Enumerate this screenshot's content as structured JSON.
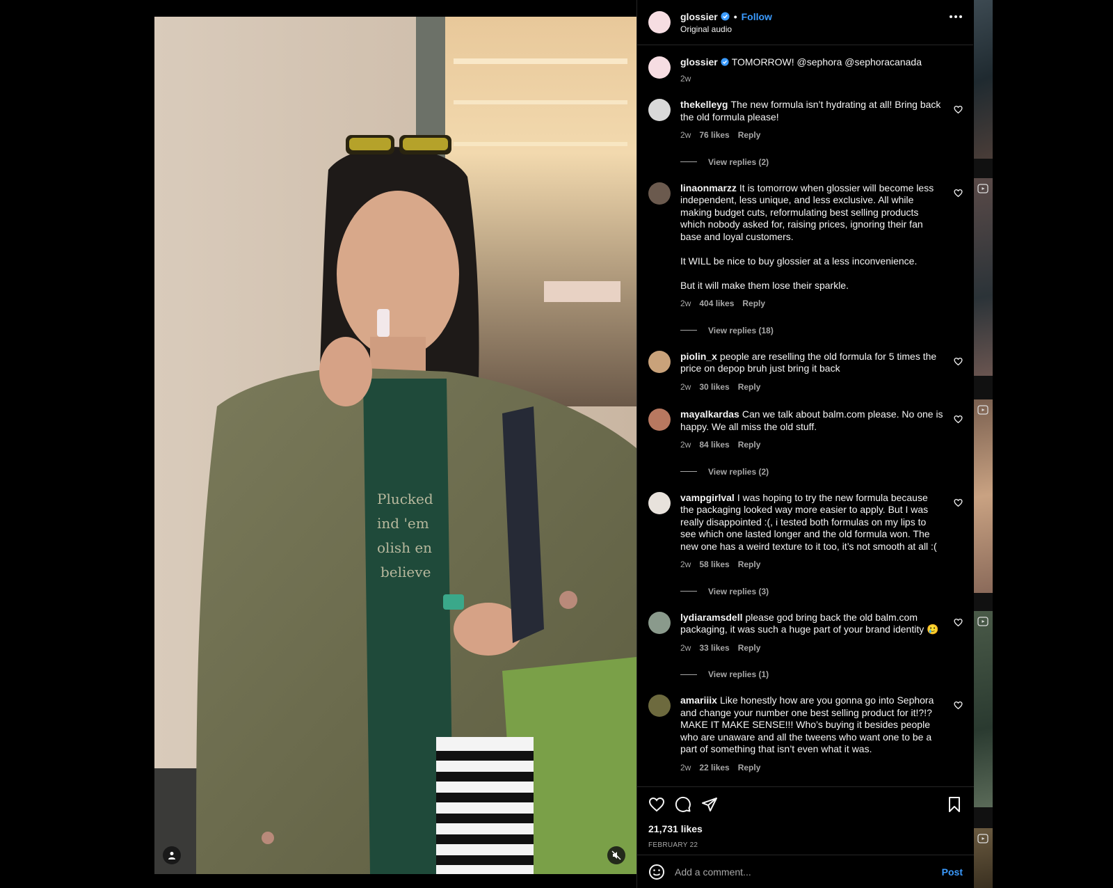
{
  "post": {
    "username": "glossier",
    "verified": true,
    "follow_label": "Follow",
    "separator": "•",
    "audio": "Original audio",
    "likes": "21,731 likes",
    "date": "FEBRUARY 22"
  },
  "caption": {
    "username": "glossier",
    "text": "TOMORROW! @sephora @sephoracanada",
    "time": "2w"
  },
  "comments": [
    {
      "user": "thekelleyg",
      "text": "The new formula isn’t hydrating at all! Bring back the old formula please!",
      "time": "2w",
      "likes": "76 likes",
      "reply": "Reply",
      "replies": "View replies (2)",
      "avatar_color": "#d9d9d9"
    },
    {
      "user": "linaonmarzz",
      "text": "It is tomorrow when glossier will become less independent, less unique, and less exclusive. All while making budget cuts, reformulating best selling products which nobody asked for, raising prices, ignoring their fan base and loyal customers.\n\nIt WILL be nice to buy glossier at a less inconvenience.\n\nBut it will make them lose their sparkle.",
      "time": "2w",
      "likes": "404 likes",
      "reply": "Reply",
      "replies": "View replies (18)",
      "avatar_color": "#6b5a4e"
    },
    {
      "user": "piolin_x",
      "text": "people are reselling the old formula for 5 times the price on depop bruh just bring it back",
      "time": "2w",
      "likes": "30 likes",
      "reply": "Reply",
      "replies": "",
      "avatar_color": "#c9a27a"
    },
    {
      "user": "mayalkardas",
      "text": "Can we talk about balm.com please. No one is happy. We all miss the old stuff.",
      "time": "2w",
      "likes": "84 likes",
      "reply": "Reply",
      "replies": "View replies (2)",
      "avatar_color": "#b87860"
    },
    {
      "user": "vampgirlval",
      "text": "I was hoping to try the new formula because the packaging looked way more easier to apply. But I was really disappointed :(, i tested both formulas on my lips to see which one lasted longer and the old formula won. The new one has a weird texture to it too, it’s not smooth at all :(",
      "time": "2w",
      "likes": "58 likes",
      "reply": "Reply",
      "replies": "View replies (3)",
      "avatar_color": "#e8e2dc"
    },
    {
      "user": "lydiaramsdell",
      "text": "please god bring back the old balm.com packaging, it was such a huge part of your brand identity 🥲",
      "time": "2w",
      "likes": "33 likes",
      "reply": "Reply",
      "replies": "View replies (1)",
      "avatar_color": "#8a9a8c"
    },
    {
      "user": "amariiix",
      "text": "Like honestly how are you gonna go into Sephora and change your number one best selling product for it!?!? MAKE IT MAKE SENSE!!! Who’s buying it besides people who are unaware and all the tweens who want one to be a part of something that isn’t even what it was.",
      "time": "2w",
      "likes": "22 likes",
      "reply": "Reply",
      "replies": "",
      "avatar_color": "#6d6a3e"
    }
  ],
  "add_comment": {
    "placeholder": "Add a comment...",
    "post_label": "Post"
  },
  "colors": {
    "link": "#3b9bff",
    "muted": "#a8a8a8",
    "avatar_brand": "#f6dde2"
  },
  "icons": [
    "verified-icon",
    "more-icon",
    "heart-icon",
    "comment-icon",
    "share-icon",
    "bookmark-icon",
    "emoji-icon",
    "user-tag-icon",
    "muted-icon",
    "reel-icon"
  ]
}
